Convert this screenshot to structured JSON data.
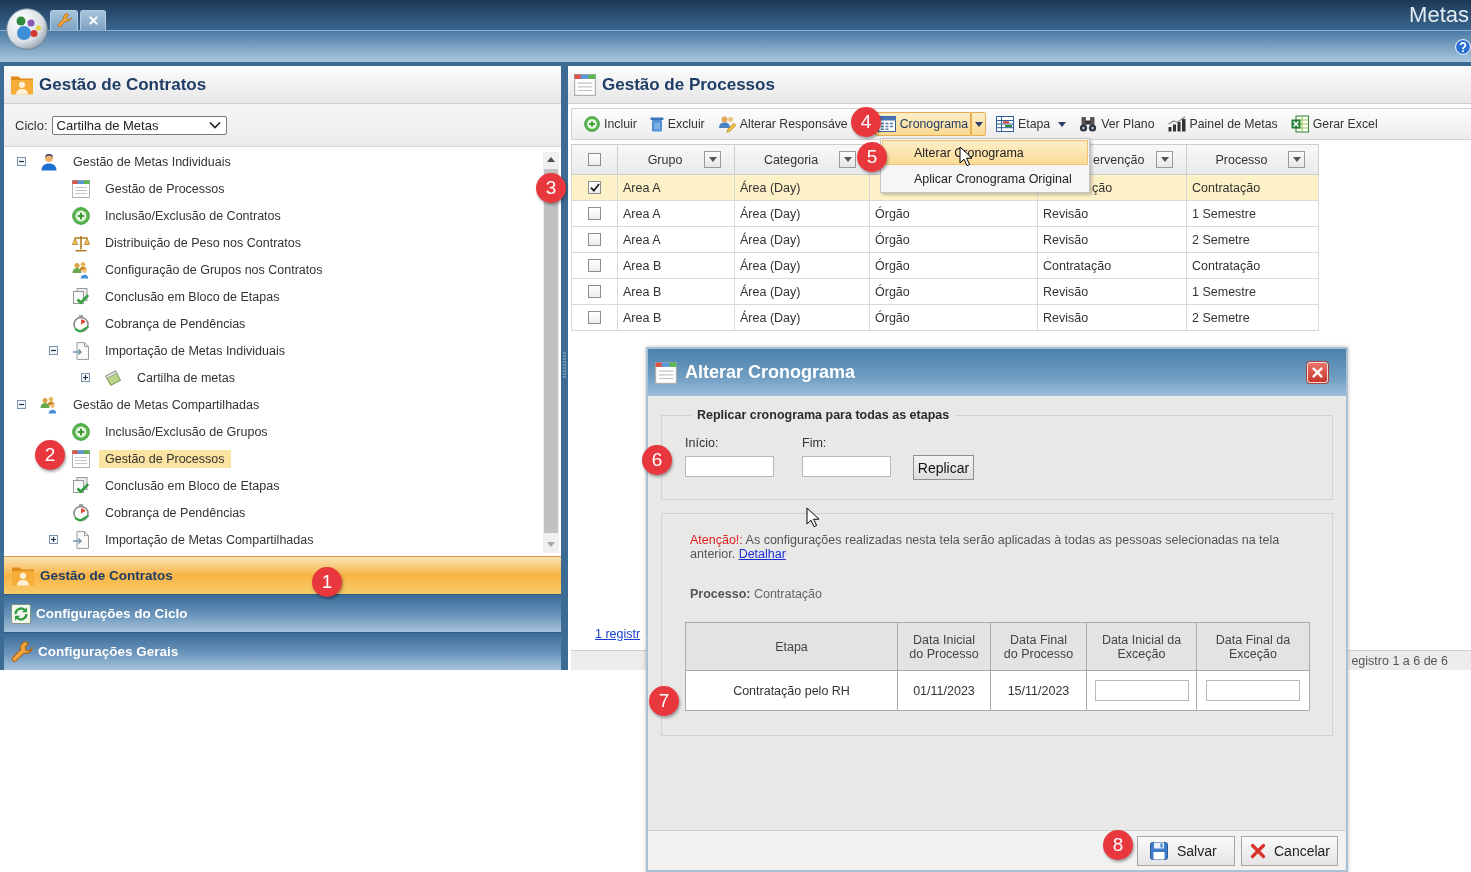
{
  "header": {
    "app_name": "Metas"
  },
  "left_panel": {
    "title": "Gestão de Contratos",
    "cycle": {
      "label": "Ciclo:",
      "value": "Cartilha de Metas"
    },
    "tree": [
      {
        "label": "Gestão de Metas Individuais",
        "expanded": true,
        "selected": false,
        "children": [
          {
            "label": "Gestão de Processos",
            "selected": false
          },
          {
            "label": "Inclusão/Exclusão de Contratos",
            "selected": false
          },
          {
            "label": "Distribuição de Peso nos Contratos",
            "selected": false
          },
          {
            "label": "Configuração de Grupos nos Contratos",
            "selected": false
          },
          {
            "label": "Conclusão em Bloco de Etapas",
            "selected": false
          },
          {
            "label": "Cobrança de Pendências",
            "selected": false
          },
          {
            "label": "Importação de Metas Individuais",
            "expanded": true,
            "selected": false,
            "children": [
              {
                "label": "Cartilha de metas",
                "expanded": false,
                "selected": false
              }
            ]
          }
        ]
      },
      {
        "label": "Gestão de Metas Compartilhadas",
        "expanded": true,
        "selected": false,
        "children": [
          {
            "label": "Inclusão/Exclusão de Grupos",
            "selected": false
          },
          {
            "label": "Gestão de Processos",
            "selected": true
          },
          {
            "label": "Conclusão em Bloco de Etapas",
            "selected": false
          },
          {
            "label": "Cobrança de Pendências",
            "selected": false
          },
          {
            "label": "Importação de Metas Compartilhadas",
            "expanded": false,
            "selected": false
          }
        ]
      }
    ],
    "accordion": [
      {
        "label": "Gestão de Contratos",
        "selected": true
      },
      {
        "label": "Configurações do Ciclo",
        "selected": false
      },
      {
        "label": "Configurações Gerais",
        "selected": false
      }
    ]
  },
  "right_panel": {
    "title": "Gestão de Processos",
    "toolbar": [
      {
        "label": "Incluir",
        "kind": "button",
        "active": false
      },
      {
        "label": "Excluir",
        "kind": "button",
        "active": false
      },
      {
        "label": "Alterar Responsáve",
        "kind": "button",
        "active": false
      },
      {
        "label": "Cronograma",
        "kind": "split",
        "active": true
      },
      {
        "label": "Etapa",
        "kind": "dropdown",
        "active": false
      },
      {
        "label": "Ver Plano",
        "kind": "button",
        "active": false
      },
      {
        "label": "Painel de Metas",
        "kind": "button",
        "active": false
      },
      {
        "label": "Gerar Excel",
        "kind": "button",
        "active": false
      }
    ],
    "menu": {
      "open": true,
      "items": [
        {
          "label": "Alterar Cronograma",
          "selected": true
        },
        {
          "label": "Aplicar Cronograma Original",
          "selected": false
        }
      ]
    },
    "table": {
      "select_all_checked": false,
      "columns": [
        "Grupo",
        "Categoria",
        null,
        "ervenção",
        "Processo"
      ],
      "rows": [
        {
          "checked": true,
          "selected": true,
          "cells": [
            "Area A",
            "Área (Day)",
            null,
            "ção",
            "Contratação"
          ]
        },
        {
          "checked": false,
          "selected": false,
          "cells": [
            "Area A",
            "Área (Day)",
            "Órgão",
            "Revisão",
            "1 Semestre"
          ]
        },
        {
          "checked": false,
          "selected": false,
          "cells": [
            "Area A",
            "Área (Day)",
            "Órgão",
            "Revisão",
            "2 Semetre"
          ]
        },
        {
          "checked": false,
          "selected": false,
          "cells": [
            "Area B",
            "Área (Day)",
            "Órgão",
            "Contratação",
            "Contratação"
          ]
        },
        {
          "checked": false,
          "selected": false,
          "cells": [
            "Area B",
            "Área (Day)",
            "Órgão",
            "Revisão",
            "1 Semestre"
          ]
        },
        {
          "checked": false,
          "selected": false,
          "cells": [
            "Area B",
            "Área (Day)",
            "Órgão",
            "Revisão",
            "2 Semetre"
          ]
        }
      ]
    },
    "pager_link": "1 registr",
    "status": "egistro 1 a 6 de 6"
  },
  "dialog": {
    "title": "Alterar Cronograma",
    "replicate": {
      "legend": "Replicar cronograma para todas as etapas",
      "fields": [
        {
          "label": "Início:"
        },
        {
          "label": "Fim:"
        }
      ],
      "button": "Replicar"
    },
    "notice": {
      "warning": "Atenção!:",
      "text": "As configurações realizadas nesta tela serão aplicadas à todas as pessoas selecionadas na tela anterior.",
      "link": "Detalhar"
    },
    "process": "**Processo:** Contratação",
    "table": {
      "columns": [
        "Etapa",
        "Data Inicial do Processo",
        "Data Final do Processo",
        "Data Inicial da Exceção",
        "Data Final da Exceção"
      ],
      "rows": [
        {
          "cells": [
            "Contratação pelo RH",
            "01/11/2023",
            "15/11/2023"
          ]
        }
      ]
    },
    "buttons": [
      {
        "label": "Salvar",
        "kind": "save"
      },
      {
        "label": "Cancelar",
        "kind": "cancel"
      }
    ]
  },
  "callouts": [
    "1",
    "2",
    "3",
    "4",
    "5",
    "6",
    "7",
    "8"
  ]
}
